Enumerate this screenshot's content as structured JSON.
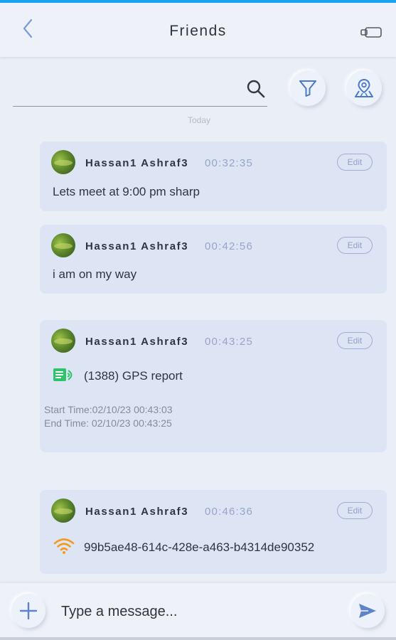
{
  "header": {
    "title": "Friends",
    "back_icon": "chevron-left-icon",
    "right_icon": "toggle-icon",
    "accent_color": "#1aa3f0"
  },
  "search": {
    "value": "",
    "placeholder": "",
    "icon": "search-icon"
  },
  "toolbar": {
    "filter_icon": "filter-icon",
    "map_icon": "map-pin-icon"
  },
  "date_divider": "Today",
  "messages": [
    {
      "sender": "Hassan1 Ashraf3",
      "time": "00:32:35",
      "edit_label": "Edit",
      "text": "Lets meet at 9:00 pm sharp"
    },
    {
      "sender": "Hassan1 Ashraf3",
      "time": "00:42:56",
      "edit_label": "Edit",
      "text": "i am on my way"
    },
    {
      "sender": "Hassan1 Ashraf3",
      "time": "00:43:25",
      "edit_label": "Edit",
      "text": "(1388) GPS report",
      "icon": "gps-report-icon",
      "start_time": "Start Time:02/10/23 00:43:03",
      "end_time": "End Time: 02/10/23 00:43:25"
    },
    {
      "sender": "Hassan1 Ashraf3",
      "time": "00:46:36",
      "edit_label": "Edit",
      "text": "99b5ae48-614c-428e-a463-b4314de90352",
      "icon": "wifi-icon"
    }
  ],
  "composer": {
    "placeholder": "Type a message...",
    "value": "",
    "add_icon": "plus-icon",
    "send_icon": "send-icon"
  }
}
